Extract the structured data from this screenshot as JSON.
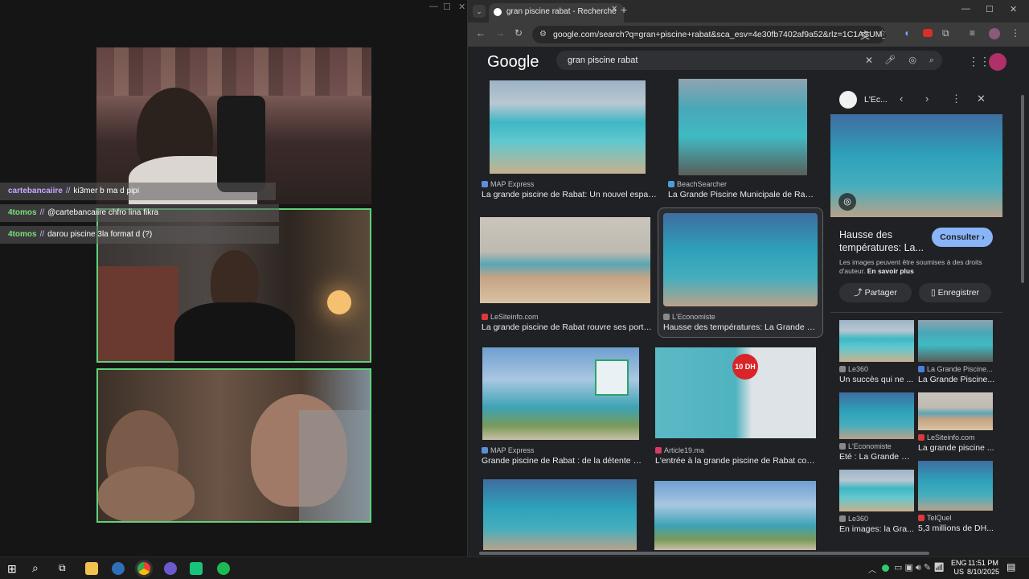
{
  "chat": [
    {
      "user": "cartebancaiire",
      "user_color": "#c9a7ff",
      "message": "ki3mer b ma d pipi"
    },
    {
      "user": "4tomos",
      "user_color": "#7be07b",
      "message": "@cartebancaiire chfro lina fikra"
    },
    {
      "user": "4tomos",
      "user_color": "#7be07b",
      "message": "darou piscine 3la format d (?)"
    }
  ],
  "browser": {
    "tab_title": "gran piscine rabat - Recherche",
    "url": "google.com/search?q=gran+piscine+rabat&sca_esv=4e30fb7402af9a52&rlz=1C1ASUM_...",
    "logo": "Google",
    "query": "gran piscine rabat"
  },
  "results": [
    {
      "source": "MAP Express",
      "caption": "La grande piscine de Rabat: Un nouvel espace ..."
    },
    {
      "source": "BeachSearcher",
      "caption": "La Grande Piscine Municipale de Rabat ..."
    },
    {
      "source": "LeSiteinfo.com",
      "caption": "La grande piscine de Rabat rouvre ses portes ..."
    },
    {
      "source": "L'Economiste",
      "caption": "Hausse des températures: La Grande pisc..."
    },
    {
      "source": "MAP Express",
      "caption": "Grande piscine de Rabat : de la détente po..."
    },
    {
      "source": "Article19.ma",
      "caption": "L'entrée à la grande piscine de Rabat coûte ..."
    }
  ],
  "thumb_badge": "10 DH",
  "panel": {
    "source": "L'Ec...",
    "title": "Hausse des températures: La...",
    "visit": "Consulter",
    "notice": "Les images peuvent être soumises à des droits d'auteur.",
    "learn_more": "En savoir plus",
    "share": "Partager",
    "save": "Enregistrer",
    "related": [
      {
        "source": "Le360",
        "caption": "Un succès qui ne ..."
      },
      {
        "source": "La Grande Piscine...",
        "caption": "La Grande Piscine..."
      },
      {
        "source": "L'Economiste",
        "caption": "Eté : La Grande pi..."
      },
      {
        "source": "LeSiteinfo.com",
        "caption": "La grande piscine ..."
      },
      {
        "source": "Le360",
        "caption": "En images: la Gra..."
      },
      {
        "source": "TelQuel",
        "caption": "5,3 millions de DH..."
      }
    ]
  },
  "taskbar": {
    "lang": "ENG",
    "region": "US",
    "time": "11:51 PM",
    "date": "8/10/2025"
  }
}
